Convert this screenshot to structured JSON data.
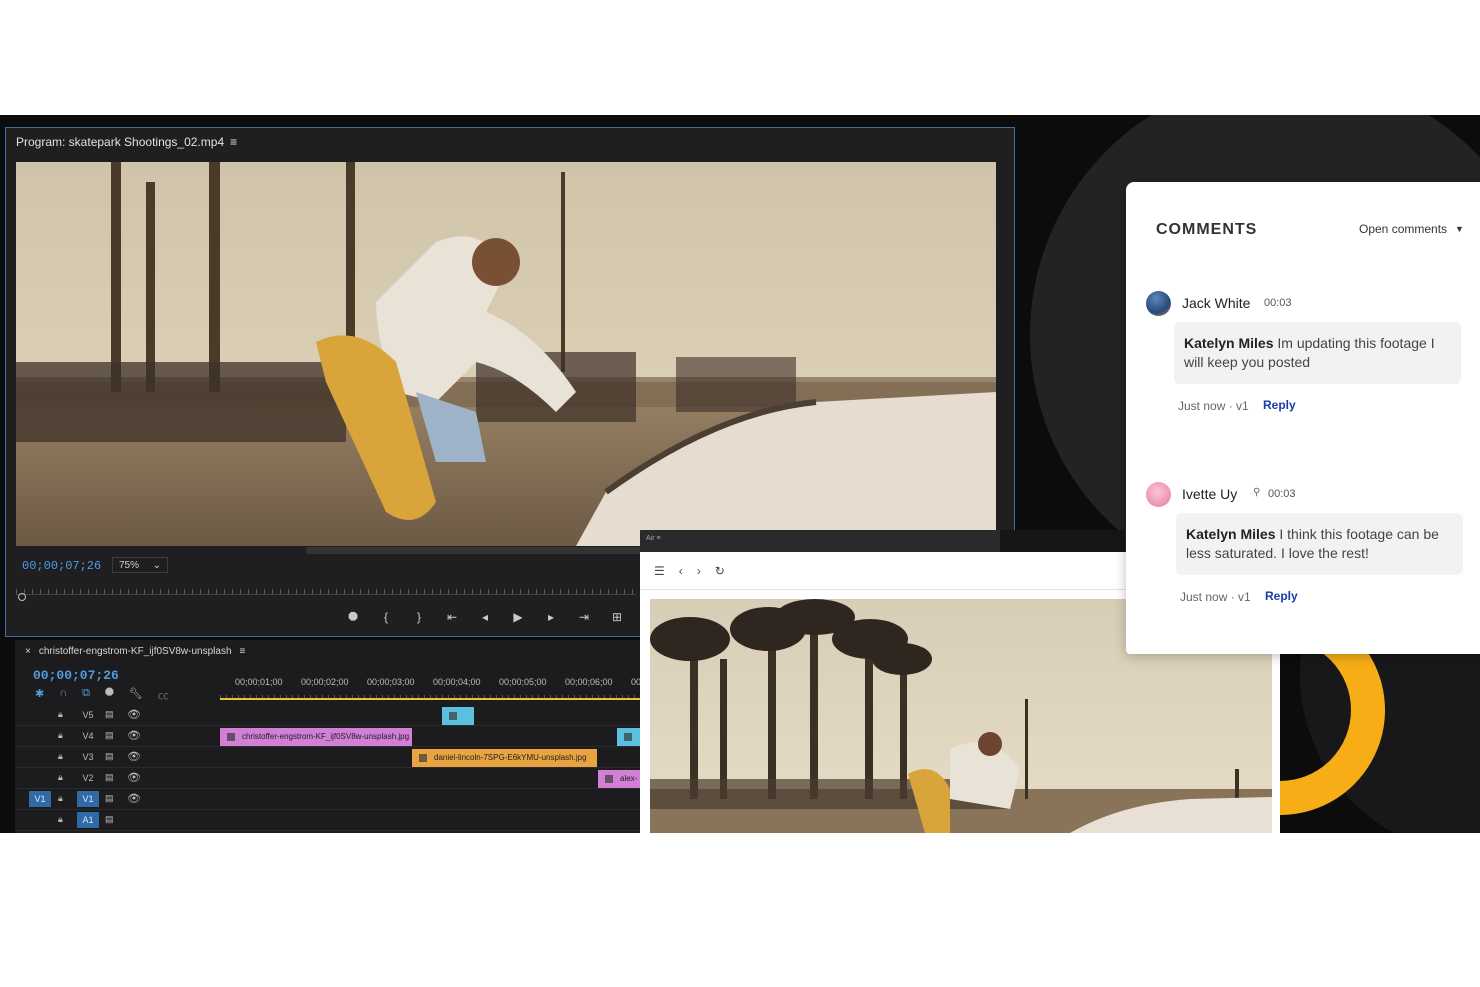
{
  "program_monitor": {
    "title": "Program: skatepark Shootings_02.mp4",
    "menu_icon": "≡",
    "timecode": "00;00;07;26",
    "zoom": "75%"
  },
  "transport_controls": [
    "marker",
    "mark-in",
    "mark-out",
    "go-to-in",
    "step-back",
    "play",
    "step-forward",
    "go-to-out",
    "lift",
    "extract"
  ],
  "timeline": {
    "sequence_name": "christoffer-engstrom-KF_ijf0SV8w-unsplash",
    "timecode": "00;00;07;26",
    "ticks": [
      "00;00;01;00",
      "00;00;02;00",
      "00;00;03;00",
      "00;00;04;00",
      "00;00;05;00",
      "00;00;06;00",
      "00"
    ],
    "tracks": [
      {
        "name": "V5"
      },
      {
        "name": "V4"
      },
      {
        "name": "V3"
      },
      {
        "name": "V2"
      },
      {
        "name": "V1",
        "source": "V1"
      },
      {
        "name": "A1"
      }
    ],
    "clips": [
      {
        "label": "christoffer-engstrom-KF_ijf0SV8w-unsplash.jpg",
        "color": "#d27fd6"
      },
      {
        "label": "daniel-lincoln-7SPG-E6kYMU-unsplash.jpg",
        "color": "#e8a440"
      },
      {
        "label": "alex-",
        "color": "#d27fd6"
      },
      {
        "label": "",
        "color": "#5bbfdf"
      },
      {
        "label": "",
        "color": "#5bbfdf"
      }
    ]
  },
  "browser": {
    "app_label": "Air",
    "menu_icon": "≡"
  },
  "comments": {
    "title": "COMMENTS",
    "filter": "Open comments",
    "items": [
      {
        "author": "Jack White",
        "time": "00:03",
        "mention": "Katelyn Miles",
        "text": " Im updating this footage I will keep you posted",
        "meta": "Just now · v1",
        "reply": "Reply"
      },
      {
        "author": "Ivette Uy",
        "time": "00:03",
        "mention": "Katelyn Miles",
        "text": " I think this footage can be less saturated. I love the rest!",
        "meta": "Just now · v1",
        "reply": "Reply"
      }
    ]
  },
  "colors": {
    "accent_blue": "#4f9be0",
    "reply_blue": "#1b3aa8",
    "deco_orange": "#f6ad16"
  }
}
